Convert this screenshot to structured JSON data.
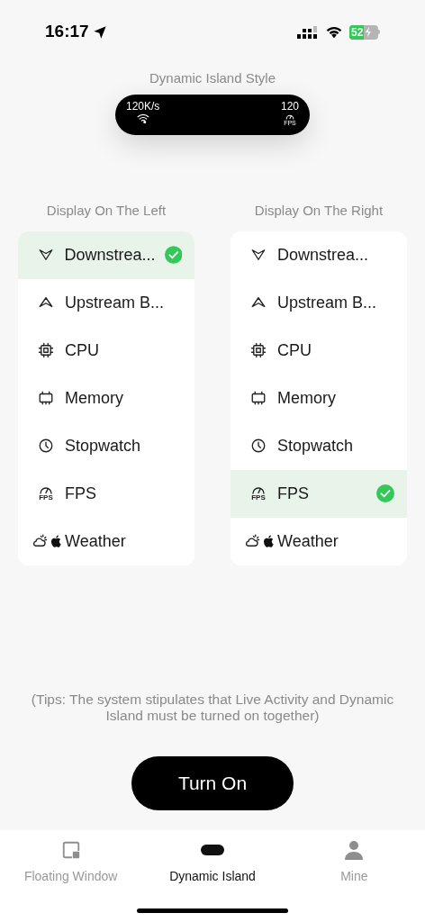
{
  "status_bar": {
    "time": "16:17",
    "battery": "52"
  },
  "title": "Dynamic Island Style",
  "island": {
    "left_value": "120K/s",
    "right_value": "120",
    "right_icon_text": "FPS"
  },
  "columns": [
    {
      "heading": "Display On The Left",
      "items": [
        {
          "kind": "down",
          "label": "Downstrea...",
          "selected": true
        },
        {
          "kind": "up",
          "label": "Upstream B...",
          "selected": false
        },
        {
          "kind": "cpu",
          "label": "CPU",
          "selected": false
        },
        {
          "kind": "memory",
          "label": "Memory",
          "selected": false
        },
        {
          "kind": "clock",
          "label": "Stopwatch",
          "selected": false
        },
        {
          "kind": "fps",
          "label": "FPS",
          "icon_text": "FPS",
          "selected": false
        },
        {
          "kind": "weather",
          "label": "Weather",
          "selected": false
        }
      ]
    },
    {
      "heading": "Display On The Right",
      "items": [
        {
          "kind": "down",
          "label": "Downstrea...",
          "selected": false
        },
        {
          "kind": "up",
          "label": "Upstream B...",
          "selected": false
        },
        {
          "kind": "cpu",
          "label": "CPU",
          "selected": false
        },
        {
          "kind": "memory",
          "label": "Memory",
          "selected": false
        },
        {
          "kind": "clock",
          "label": "Stopwatch",
          "selected": false
        },
        {
          "kind": "fps",
          "label": "FPS",
          "icon_text": "FPS",
          "selected": true
        },
        {
          "kind": "weather",
          "label": "Weather",
          "selected": false
        }
      ]
    }
  ],
  "tips": "(Tips: The system stipulates that Live Activity and Dynamic Island must be turned on together)",
  "button": "Turn On",
  "tabs": [
    {
      "kind": "window",
      "label": "Floating Window",
      "selected": false
    },
    {
      "kind": "island",
      "label": "Dynamic Island",
      "selected": true
    },
    {
      "kind": "person",
      "label": "Mine",
      "selected": false
    }
  ]
}
